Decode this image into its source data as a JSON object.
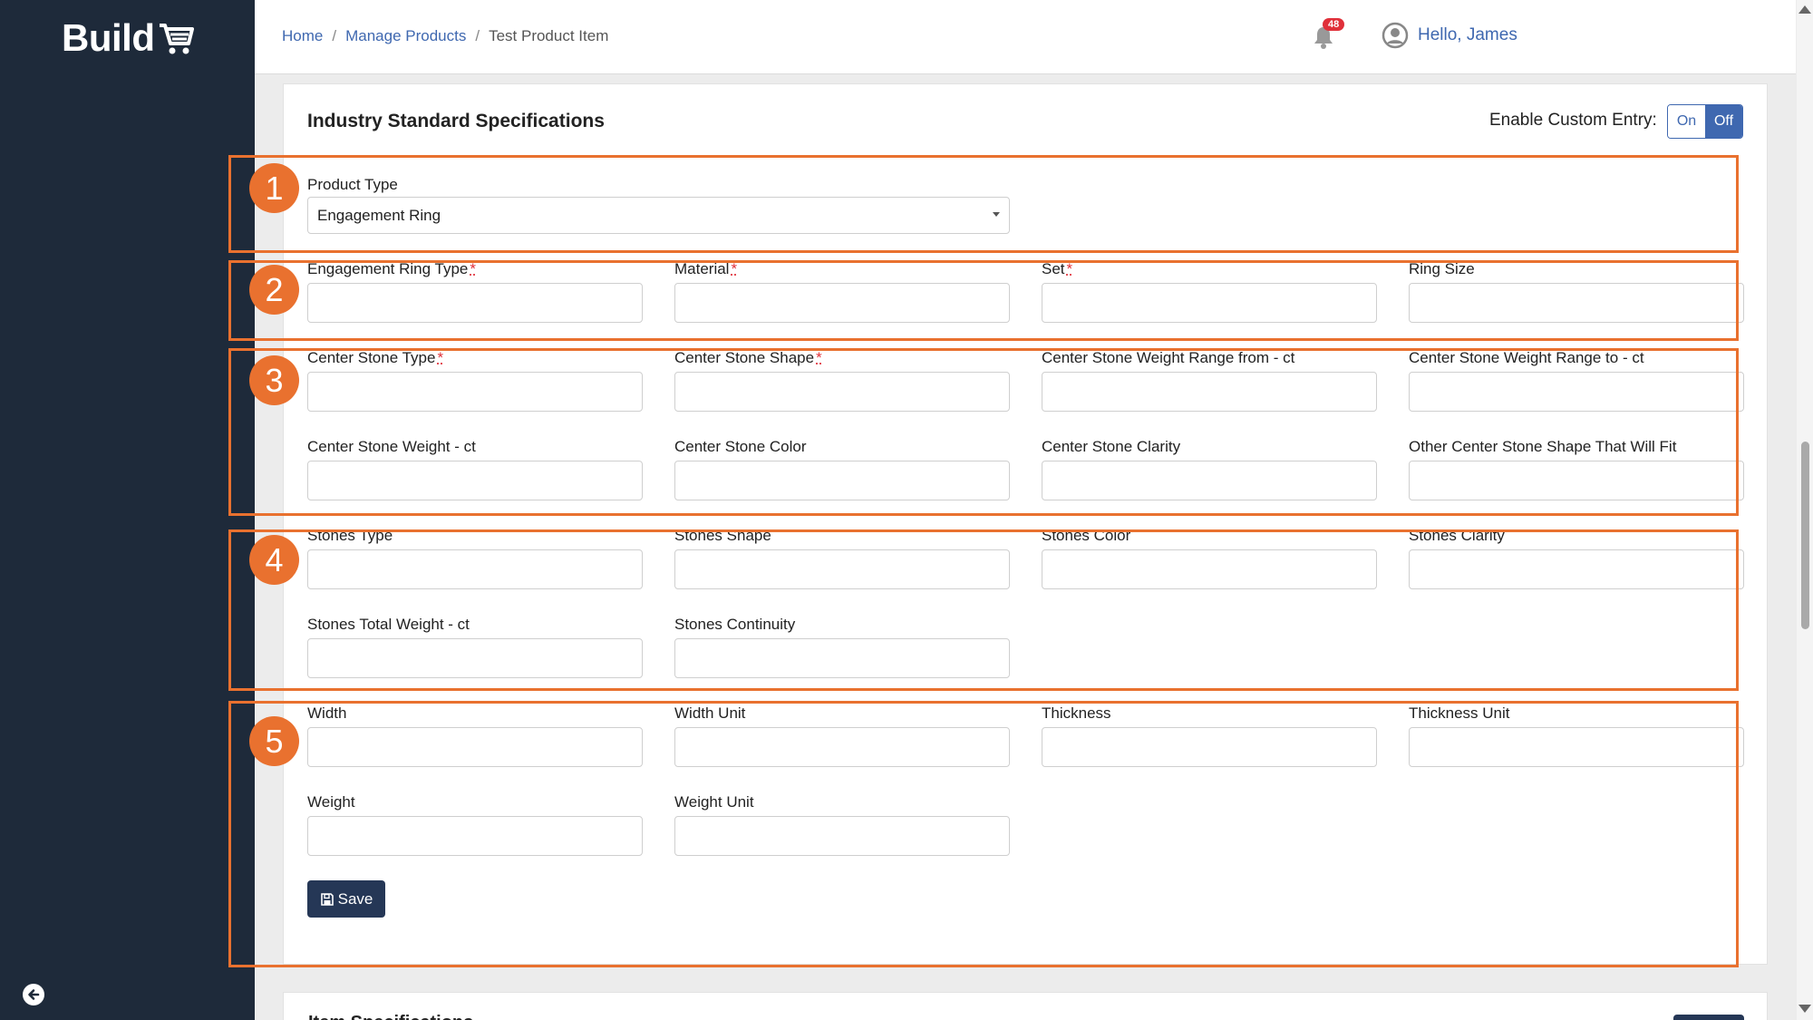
{
  "sidebar": {
    "logo_text": "Build",
    "logo_icon": "cart-icon",
    "collapse_icon": "arrow-left-circle-icon"
  },
  "header": {
    "breadcrumb": [
      "Home",
      "Manage Products",
      "Test Product Item"
    ],
    "notification_count": "48",
    "greeting": "Hello, James"
  },
  "section": {
    "title": "Industry Standard Specifications",
    "custom_entry_label": "Enable Custom Entry:",
    "toggle_on": "On",
    "toggle_off": "Off",
    "toggle_state": "Off"
  },
  "product_type": {
    "label": "Product Type",
    "value": "Engagement Ring"
  },
  "fields": [
    {
      "label": "Engagement Ring Type",
      "required": true,
      "value": ""
    },
    {
      "label": "Material",
      "required": true,
      "value": ""
    },
    {
      "label": "Set",
      "required": true,
      "value": ""
    },
    {
      "label": "Ring Size",
      "required": false,
      "value": ""
    },
    {
      "label": "Center Stone Type",
      "required": true,
      "value": ""
    },
    {
      "label": "Center Stone Shape",
      "required": true,
      "value": ""
    },
    {
      "label": "Center Stone Weight Range from - ct",
      "required": false,
      "value": ""
    },
    {
      "label": "Center Stone Weight Range to - ct",
      "required": false,
      "value": ""
    },
    {
      "label": "Center Stone Weight - ct",
      "required": false,
      "value": ""
    },
    {
      "label": "Center Stone Color",
      "required": false,
      "value": ""
    },
    {
      "label": "Center Stone Clarity",
      "required": false,
      "value": ""
    },
    {
      "label": "Other Center Stone Shape That Will Fit",
      "required": false,
      "value": ""
    },
    {
      "label": "Stones Type",
      "required": false,
      "value": ""
    },
    {
      "label": "Stones Shape",
      "required": false,
      "value": ""
    },
    {
      "label": "Stones Color",
      "required": false,
      "value": ""
    },
    {
      "label": "Stones Clarity",
      "required": false,
      "value": ""
    },
    {
      "label": "Stones Total Weight - ct",
      "required": false,
      "value": ""
    },
    {
      "label": "Stones Continuity",
      "required": false,
      "value": ""
    },
    {
      "label": "Width",
      "required": false,
      "value": ""
    },
    {
      "label": "Width Unit",
      "required": false,
      "value": ""
    },
    {
      "label": "Thickness",
      "required": false,
      "value": ""
    },
    {
      "label": "Thickness Unit",
      "required": false,
      "value": ""
    },
    {
      "label": "Weight",
      "required": false,
      "value": ""
    },
    {
      "label": "Weight Unit",
      "required": false,
      "value": ""
    }
  ],
  "required_marker": "*",
  "save_label": "Save",
  "next_section_title": "Item Specifications",
  "annotations": [
    "1",
    "2",
    "3",
    "4",
    "5"
  ],
  "colors": {
    "sidebar": "#1e2a3a",
    "accent": "#3f68b0",
    "button": "#253756",
    "annotation": "#e9712f",
    "badge": "#e0303a"
  }
}
